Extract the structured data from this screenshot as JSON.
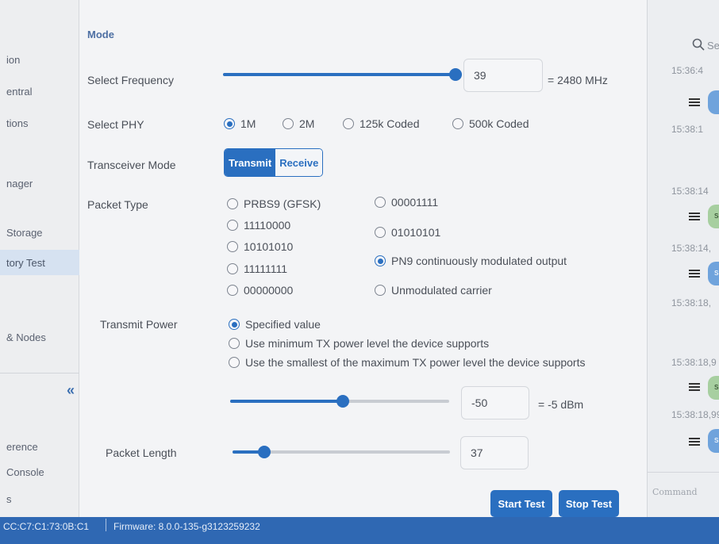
{
  "sidebar": {
    "items": [
      {
        "label": "ion",
        "active": false
      },
      {
        "label": "entral",
        "active": false
      },
      {
        "label": "tions",
        "active": false
      },
      {
        "label": "nager",
        "active": false
      },
      {
        "label": "Storage",
        "active": false
      },
      {
        "label": "tory Test",
        "active": true
      },
      {
        "label": "& Nodes",
        "active": false
      },
      {
        "label": "erence",
        "active": false
      },
      {
        "label": "Console",
        "active": false
      },
      {
        "label": "s",
        "active": false
      }
    ],
    "collapse_label": "«"
  },
  "main": {
    "mode_title": "Mode",
    "frequency": {
      "label": "Select Frequency",
      "value": "39",
      "unit": "= 2480 MHz",
      "slider_fraction": 1.0
    },
    "phy": {
      "label": "Select PHY",
      "options": [
        "1M",
        "2M",
        "125k Coded",
        "500k Coded"
      ],
      "selected": "1M"
    },
    "transceiver": {
      "label": "Transceiver Mode",
      "options": [
        "Transmit",
        "Receive"
      ],
      "selected": "Transmit"
    },
    "packet_type": {
      "label": "Packet Type",
      "col1": [
        "PRBS9 (GFSK)",
        "11110000",
        "10101010",
        "11111111",
        "00000000"
      ],
      "col2": [
        "00001111",
        "01010101",
        "PN9 continuously modulated output",
        "Unmodulated carrier"
      ],
      "selected": "PN9 continuously modulated output"
    },
    "transmit_power": {
      "label": "Transmit Power",
      "options": [
        "Specified value",
        "Use minimum TX power level the device supports",
        "Use the smallest of the maximum TX power level the device supports"
      ],
      "selected": "Specified value",
      "value": "-50",
      "unit": "= -5 dBm",
      "slider_fraction": 0.52
    },
    "packet_length": {
      "label": "Packet Length",
      "value": "37",
      "slider_fraction": 0.15
    },
    "buttons": {
      "start": "Start Test",
      "stop": "Stop Test"
    }
  },
  "right_panel": {
    "search_placeholder": "Se",
    "timestamps": [
      "15:36:4",
      "15:38:1",
      "15:38:14",
      "15:38:14,",
      "15:38:18,",
      "15:38:18,9",
      "15:38:18,99"
    ],
    "bubbles": [
      "",
      "s",
      "sl",
      "sl_",
      "sl_b"
    ],
    "command_placeholder": "Command"
  },
  "statusbar": {
    "mac": "CC:C7:C1:73:0B:C1",
    "firmware": "Firmware: 8.0.0-135-g3123259232"
  },
  "colors": {
    "accent": "#2a6fc0",
    "statusbar": "#2f68b3"
  }
}
